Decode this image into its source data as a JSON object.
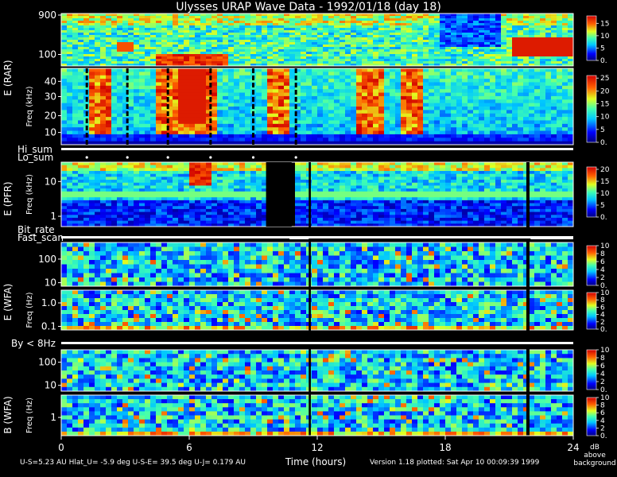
{
  "chart_data": {
    "type": "heatmap",
    "title": "Ulysses URAP Wave Data - 1992/01/18  (day 18)",
    "xlabel": "Time (hours)",
    "xlim": [
      0,
      24
    ],
    "x_ticks": [
      "0",
      "6",
      "12",
      "18",
      "24"
    ],
    "footer_left": "U-S=5.23 AU  Hlat_U= -5.9 deg  U-S-E= 39.5 deg  U-J= 0.179 AU",
    "footer_right": "Version 1.18 plotted: Sat Apr 10 00:09:39 1999",
    "colorbar_unit": [
      "dB",
      "above",
      "background"
    ],
    "strip_labels": [
      "Hi_sum",
      "Lo_sum",
      "Bit_rate",
      "Fast_scan",
      "By < 8Hz"
    ],
    "group_labels": [
      "E  (RAR)",
      "E  (PFR)",
      "E  (WFA)",
      "B  (WFA)"
    ],
    "panels": [
      {
        "ylabel": "",
        "yticks": [
          "900",
          "100"
        ],
        "yscale": "log",
        "colorbar_ticks": [
          "15",
          "10",
          "5",
          "0."
        ],
        "colorbar_max": 18
      },
      {
        "ylabel": "Freq (kHz)",
        "yticks": [
          "40",
          "30",
          "20",
          "10"
        ],
        "yscale": "linear",
        "colorbar_ticks": [
          "25",
          "20",
          "15",
          "10",
          "5",
          "0."
        ],
        "colorbar_max": 26
      },
      {
        "ylabel": "Freq (kHz)",
        "yticks": [
          "10",
          "1"
        ],
        "yscale": "log",
        "colorbar_ticks": [
          "20",
          "15",
          "10",
          "5",
          "0."
        ],
        "colorbar_max": 21
      },
      {
        "ylabel": "",
        "yticks": [
          "100",
          "10"
        ],
        "yscale": "log",
        "colorbar_ticks": [
          "10",
          "8",
          "6",
          "4",
          "2",
          "0."
        ],
        "colorbar_max": 10
      },
      {
        "ylabel": "Freq (Hz)",
        "yticks": [
          "1.0",
          "0.1"
        ],
        "yscale": "log",
        "colorbar_ticks": [
          "10",
          "8",
          "6",
          "4",
          "2",
          "0."
        ],
        "colorbar_max": 10
      },
      {
        "ylabel": "",
        "yticks": [
          "100",
          "10"
        ],
        "yscale": "log",
        "colorbar_ticks": [
          "10",
          "8",
          "6",
          "4",
          "2",
          "0."
        ],
        "colorbar_max": 10
      },
      {
        "ylabel": "Freq (Hz)",
        "yticks": [
          "1"
        ],
        "yscale": "log",
        "colorbar_ticks": [
          "10",
          "8",
          "6",
          "4",
          "2",
          "0."
        ],
        "colorbar_max": 10
      }
    ],
    "markers_hours": [
      1.2,
      3.1,
      5.0,
      7.0,
      9.0,
      11.0
    ]
  }
}
